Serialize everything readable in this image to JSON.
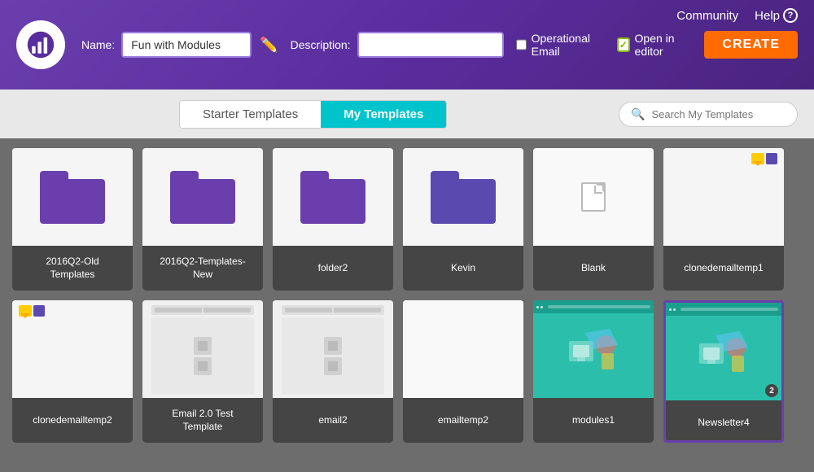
{
  "app": {
    "logo_alt": "EmailUplers logo"
  },
  "header": {
    "nav": {
      "community": "Community",
      "help": "Help"
    },
    "form": {
      "name_label": "Name:",
      "name_value": "Fun with Modules",
      "description_label": "Description:",
      "description_value": "",
      "operational_email_label": "Operational Email",
      "open_in_editor_label": "Open in editor",
      "create_button": "CREATE"
    }
  },
  "toolbar": {
    "tab_starter": "Starter Templates",
    "tab_my": "My Templates",
    "search_placeholder": "Search My Templates"
  },
  "grid": {
    "row1": [
      {
        "id": "2016q2old",
        "label": "2016Q2-Old\nTemplates",
        "type": "folder",
        "color": "#6a3fad"
      },
      {
        "id": "2016q2new",
        "label": "2016Q2-Templates-\nNew",
        "type": "folder",
        "color": "#6a3fad"
      },
      {
        "id": "folder2",
        "label": "folder2",
        "type": "folder",
        "color": "#6a3fad"
      },
      {
        "id": "kevin",
        "label": "Kevin",
        "type": "folder",
        "color": "#6a3fad"
      },
      {
        "id": "blank",
        "label": "Blank",
        "type": "blank"
      },
      {
        "id": "clonedemail1",
        "label": "clonedemailtemp1",
        "type": "email_preview_star"
      }
    ],
    "row2": [
      {
        "id": "clonedemail2",
        "label": "clonedemailtemp2",
        "type": "email_preview_star"
      },
      {
        "id": "email2test",
        "label": "Email 2.0 Test\nTemplate",
        "type": "email_preview_two_col"
      },
      {
        "id": "email2",
        "label": "email2",
        "type": "email_preview_two_col"
      },
      {
        "id": "emailtemp2",
        "label": "emailtemp2",
        "type": "blank_white"
      },
      {
        "id": "modules1",
        "label": "modules1",
        "type": "green_preview"
      },
      {
        "id": "newsletter4",
        "label": "Newsletter4",
        "type": "green_preview_selected",
        "badge": "2"
      }
    ]
  }
}
